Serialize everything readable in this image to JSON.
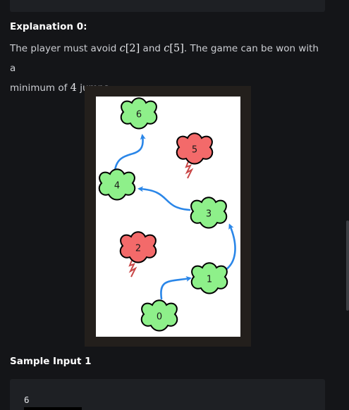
{
  "explanation": {
    "heading": "Explanation 0:",
    "line1_prefix": "The player must avoid ",
    "var_c": "c",
    "idx_a": "[2]",
    "and_word": " and ",
    "idx_b": "[5]",
    "line1_suffix": ". The game can be won with a",
    "line2_prefix": "minimum of ",
    "jumps": "4",
    "line2_suffix": " jumps:"
  },
  "figure": {
    "clouds": [
      {
        "label": "0",
        "kind": "safe"
      },
      {
        "label": "1",
        "kind": "safe"
      },
      {
        "label": "2",
        "kind": "thunder"
      },
      {
        "label": "3",
        "kind": "safe"
      },
      {
        "label": "4",
        "kind": "safe"
      },
      {
        "label": "5",
        "kind": "thunder"
      },
      {
        "label": "6",
        "kind": "safe"
      }
    ],
    "path": [
      "0",
      "1",
      "3",
      "4",
      "6"
    ],
    "colors": {
      "safe_cloud": "#8ef08a",
      "thunder_cloud": "#f36a6a",
      "arrow": "#2a86e8",
      "outline": "#000000"
    }
  },
  "sample": {
    "heading": "Sample Input 1",
    "code_first_line": "6"
  }
}
